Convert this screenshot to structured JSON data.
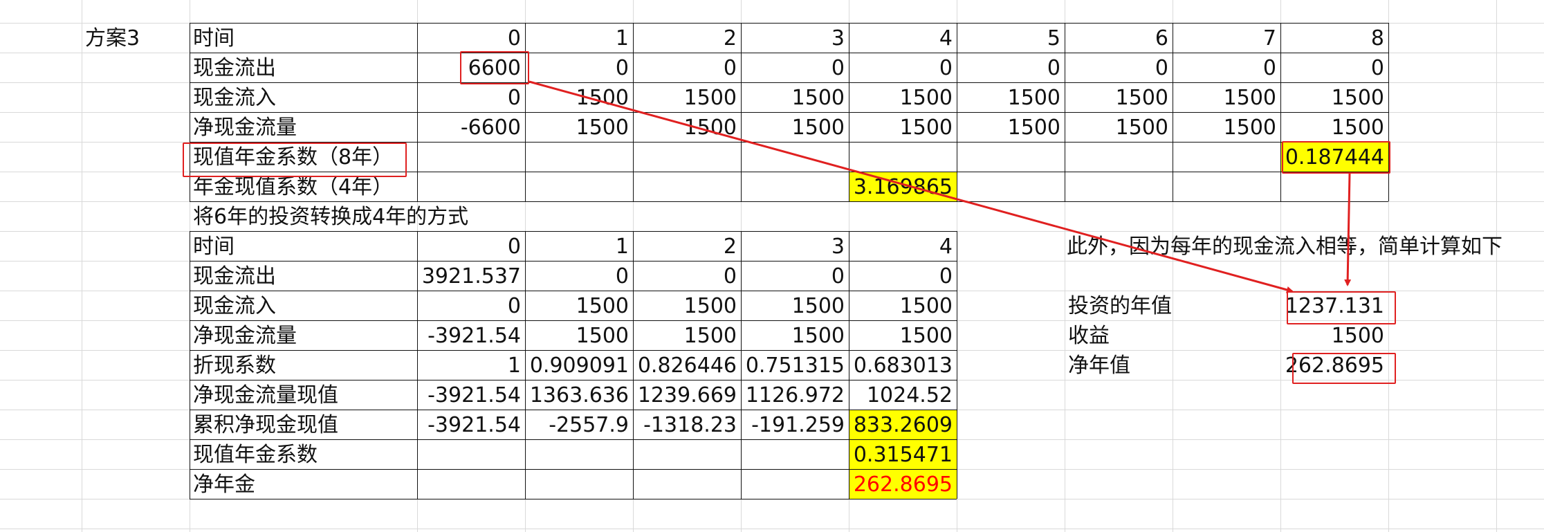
{
  "plan_label": "方案3",
  "top_table": {
    "time_label": "时间",
    "times": [
      "0",
      "1",
      "2",
      "3",
      "4",
      "5",
      "6",
      "7",
      "8"
    ],
    "rows": [
      {
        "label": "现金流出",
        "values": [
          "6600",
          "0",
          "0",
          "0",
          "0",
          "0",
          "0",
          "0",
          "0"
        ]
      },
      {
        "label": "现金流入",
        "values": [
          "0",
          "1500",
          "1500",
          "1500",
          "1500",
          "1500",
          "1500",
          "1500",
          "1500"
        ]
      },
      {
        "label": "净现金流量",
        "values": [
          "-6600",
          "1500",
          "1500",
          "1500",
          "1500",
          "1500",
          "1500",
          "1500",
          "1500"
        ]
      }
    ],
    "annuity_8_label": "现值年金系数（8年）",
    "annuity_8_value": "0.187444",
    "pv_4_label": "年金现值系数（4年）",
    "pv_4_value": "3.169865"
  },
  "conversion_title": "将6年的投资转换成4年的方式",
  "bottom_table": {
    "time_label": "时间",
    "times": [
      "0",
      "1",
      "2",
      "3",
      "4"
    ],
    "rows": [
      {
        "label": "现金流出",
        "values": [
          "3921.537",
          "0",
          "0",
          "0",
          "0"
        ]
      },
      {
        "label": "现金流入",
        "values": [
          "0",
          "1500",
          "1500",
          "1500",
          "1500"
        ]
      },
      {
        "label": "净现金流量",
        "values": [
          "-3921.54",
          "1500",
          "1500",
          "1500",
          "1500"
        ]
      },
      {
        "label": "折现系数",
        "values": [
          "1",
          "0.909091",
          "0.826446",
          "0.751315",
          "0.683013"
        ]
      },
      {
        "label": "净现金流量现值",
        "values": [
          "-3921.54",
          "1363.636",
          "1239.669",
          "1126.972",
          "1024.52"
        ]
      },
      {
        "label": "累积净现金现值",
        "values": [
          "-3921.54",
          "-2557.9",
          "-1318.23",
          "-191.259",
          "833.2609"
        ]
      }
    ],
    "annuity_label": "现值年金系数",
    "annuity_value": "0.315471",
    "net_annuity_label": "净年金",
    "net_annuity_value": "262.8695"
  },
  "side_calc": {
    "note": "此外，因为每年的现金流入相等，简单计算如下",
    "rows": [
      {
        "label": "投资的年值",
        "value": "1237.131"
      },
      {
        "label": "收益",
        "value": "1500"
      },
      {
        "label": "净年值",
        "value": "262.8695"
      }
    ]
  },
  "colors": {
    "highlight": "#ffff00",
    "annotation_red": "#e02020",
    "result_text": "#ff0000"
  }
}
